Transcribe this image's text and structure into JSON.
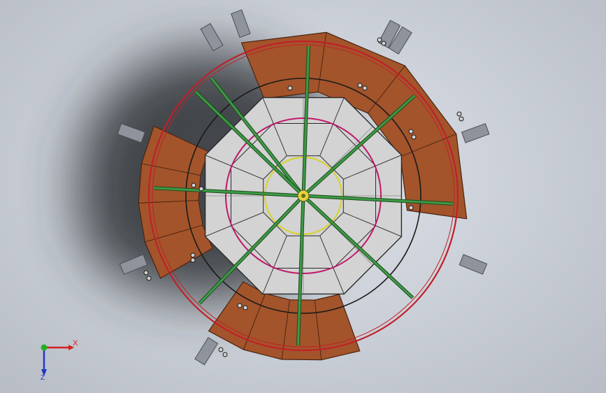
{
  "viewport": {
    "background": "#cfd4dc",
    "shadow_color": "#2b2d31"
  },
  "model": {
    "plate_color": "#a3542a",
    "plate_edge": "#4a2412",
    "bracket_color": "#8e939c",
    "floor_fill": "#d3d3d3",
    "floor_edge": "#2a2a2a",
    "spoke_color": "#3d9a45",
    "outer_ring_color": "#c0202a",
    "black_ring_color": "#1a1a1a",
    "magenta_ring_color": "#c0186a",
    "yellow_ring_color": "#d8d21a",
    "hub_color": "#e4d23a"
  },
  "triad": {
    "x_label": "X",
    "z_label": "Z",
    "x_color": "#d22020",
    "y_color": "#25b025",
    "z_color": "#2038c8"
  }
}
